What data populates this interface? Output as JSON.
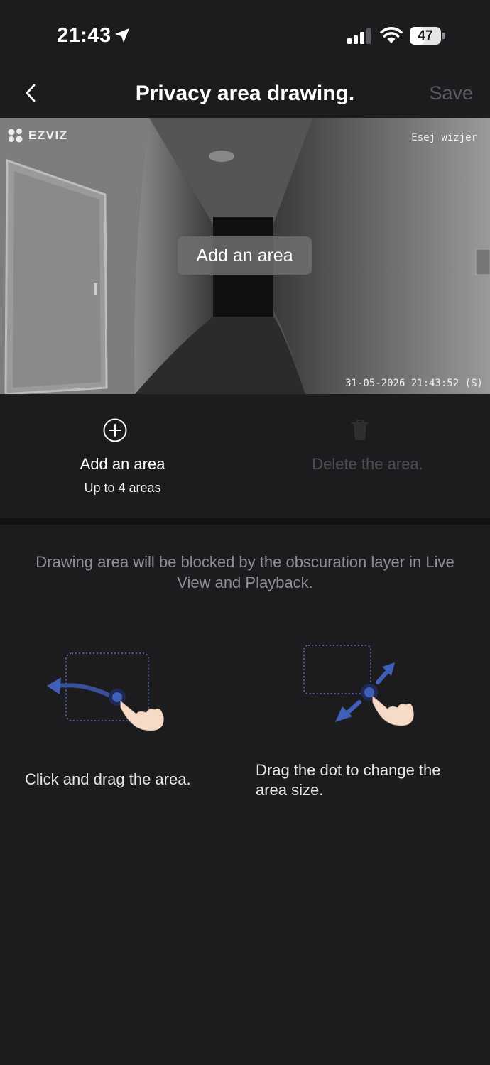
{
  "status_bar": {
    "time": "21:43",
    "battery": "47",
    "battery_level": 0.47
  },
  "header": {
    "title": "Privacy area drawing.",
    "save_label": "Save"
  },
  "camera": {
    "brand": "EZVIZ",
    "device_name": "Esej wizjer",
    "timestamp": "31-05-2026 21:43:52 (S)",
    "overlay_label": "Add an area"
  },
  "actions": {
    "add_label": "Add an area",
    "add_sub": "Up to 4 areas",
    "delete_label": "Delete the area."
  },
  "info": "Drawing area will be blocked by the obscuration layer in Live View and Playback.",
  "tips": [
    {
      "caption": "Click and drag the area."
    },
    {
      "caption": "Drag the dot to change the area size."
    }
  ],
  "colors": {
    "background": "#1c1c1e",
    "accent_arrow": "#3f5fb8",
    "disabled": "#4e4e52",
    "muted_text": "#8e8e93"
  }
}
